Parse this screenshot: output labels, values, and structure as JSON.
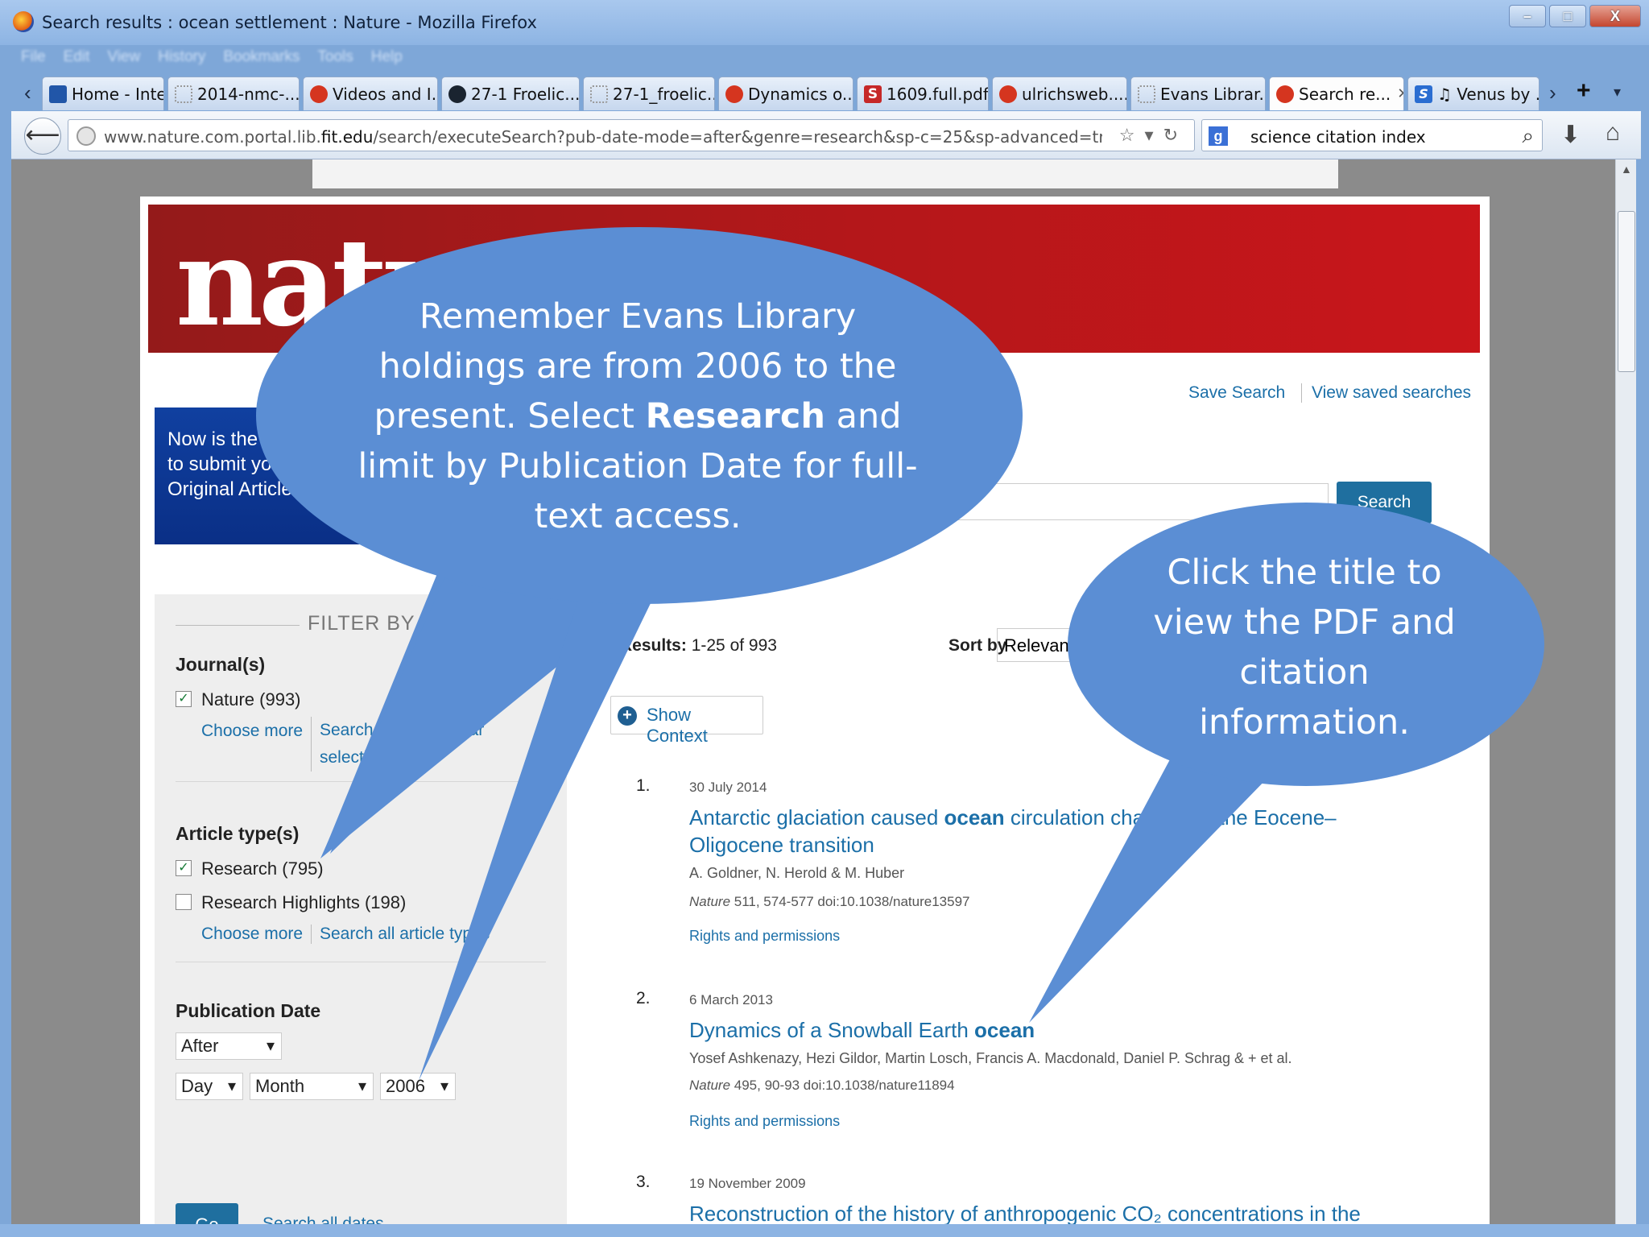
{
  "window": {
    "title": "Search results : ocean settlement : Nature - Mozilla Firefox",
    "controls": [
      "–",
      "□",
      "X"
    ],
    "menu": [
      "File",
      "Edit",
      "View",
      "History",
      "Bookmarks",
      "Tools",
      "Help"
    ]
  },
  "tabs": [
    {
      "label": "Home - Inte...",
      "icon": "ic-blue"
    },
    {
      "label": "2014-nmc-...",
      "icon": "ic-blank"
    },
    {
      "label": "Videos and I...",
      "icon": "ic-red"
    },
    {
      "label": "27-1 Froelic...",
      "icon": "ic-dark"
    },
    {
      "label": "27-1_froelic...",
      "icon": "ic-blank"
    },
    {
      "label": "Dynamics o...",
      "icon": "ic-red"
    },
    {
      "label": "1609.full.pdf",
      "icon": "ic-s"
    },
    {
      "label": "ulrichsweb....",
      "icon": "ic-red"
    },
    {
      "label": "Evans Librar...",
      "icon": "ic-blank"
    },
    {
      "label": "Search re...",
      "icon": "ic-red"
    },
    {
      "label": "♫ Venus by ...",
      "icon": "ic-s2"
    }
  ],
  "nav": {
    "url_prefix": "www.nature.com.portal.lib.",
    "url_domain": "fit.edu",
    "url_path": "/search/executeSearch?pub-date-mode=after&genre=research&sp-c=25&sp-advanced=true&sp-q",
    "search_value": "science citation index"
  },
  "page": {
    "logo": "nature",
    "save_search": "Save Search",
    "view_saved": "View saved searches",
    "promo_lines": [
      "Now is the",
      "to submit yo",
      "Original Article"
    ],
    "search_button": "Search",
    "filter": {
      "title": "FILTER BY",
      "journals_heading": "Journal(s)",
      "journal_nature": "Nature (993)",
      "choose_more": "Choose more",
      "search_journals": "Search journals (clear selection)",
      "article_type_heading": "Article type(s)",
      "research": "Research (795)",
      "research_highlights": "Research Highlights (198)",
      "search_all_types": "Search all article types",
      "pub_date_heading": "Publication Date",
      "mode": "After",
      "day": "Day",
      "month": "Month",
      "year": "2006",
      "go": "Go",
      "search_all_dates": "Search all dates"
    },
    "results": {
      "count_label": "Results:",
      "count_value": "1-25 of 993",
      "sort_label": "Sort by",
      "sort_value": "Relevance",
      "show_context": "Show Context",
      "items": [
        {
          "num": "1.",
          "date": "30 July 2014",
          "title_pre": "Antarctic glaciation caused ",
          "title_bold": "ocean",
          "title_post": " circulation changes at the Eocene–Oligocene transition",
          "authors": "A. Goldner,  N. Herold &  M. Huber",
          "journal": "Nature",
          "cite": " 511, 574-577 doi:10.1038/nature13597",
          "rights": "Rights and permissions"
        },
        {
          "num": "2.",
          "date": "6 March 2013",
          "title_pre": "Dynamics of a Snowball Earth ",
          "title_bold": "ocean",
          "title_post": "",
          "authors": "Yosef Ashkenazy,  Hezi Gildor,  Martin Losch,  Francis A. Macdonald,  Daniel P. Schrag &  + et al.",
          "journal": "Nature",
          "cite": " 495, 90-93 doi:10.1038/nature11894",
          "rights": "Rights and permissions"
        },
        {
          "num": "3.",
          "date": "19 November 2009",
          "title_pre": "Reconstruction of the history of anthropogenic CO₂ concentrations in the",
          "title_bold": "",
          "title_post": ""
        }
      ]
    }
  },
  "callouts": {
    "one_pre": "Remember Evans Library holdings are from 2006 to the present. Select ",
    "one_bold": "Research",
    "one_post": " and limit by Publication Date for full-text access.",
    "two": "Click the title to view the PDF and citation information.",
    "color": "#5b8ed4"
  }
}
